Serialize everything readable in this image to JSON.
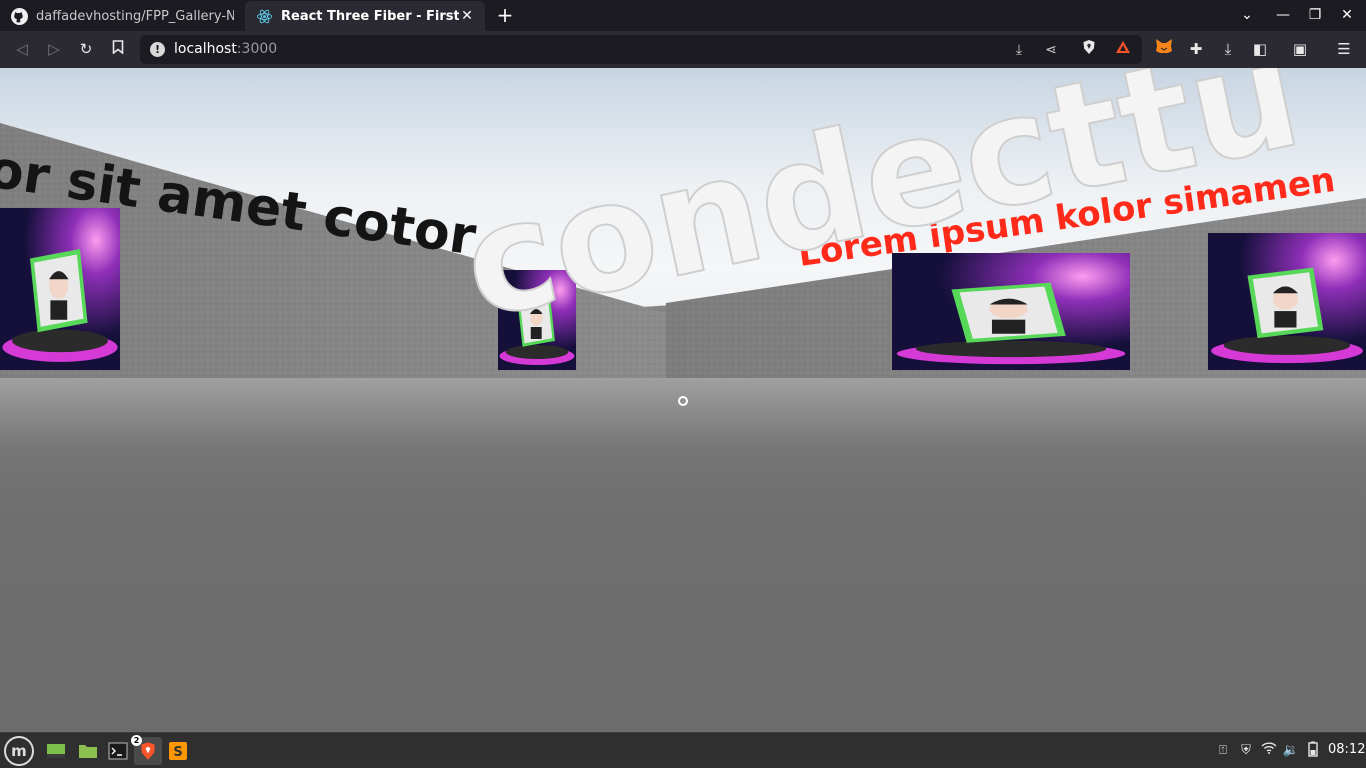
{
  "tabs": [
    {
      "title": "daffadevhosting/FPP_Gallery-NFT",
      "icon": "github-icon"
    },
    {
      "title": "React Three Fiber - First Person",
      "icon": "react-icon"
    }
  ],
  "url": {
    "host": "localhost",
    "port": ":3000"
  },
  "scene": {
    "left_wall_text": "or sit amet cotor",
    "big_3d_text": "condecttu",
    "red_text": "Lorem ipsum kolor simamen"
  },
  "taskbar": {
    "clock": "08:12",
    "brave_badge": "2",
    "apps": [
      "linux-mint-menu-icon",
      "show-desktop-icon",
      "files-icon",
      "terminal-icon",
      "brave-browser-icon",
      "sublime-text-icon"
    ]
  },
  "colors": {
    "tab_bg": "#1c1b22",
    "toolbar_bg": "#2b2a33",
    "red_text": "#ff2a1a",
    "taskbar_bg": "#2f2f2f"
  }
}
